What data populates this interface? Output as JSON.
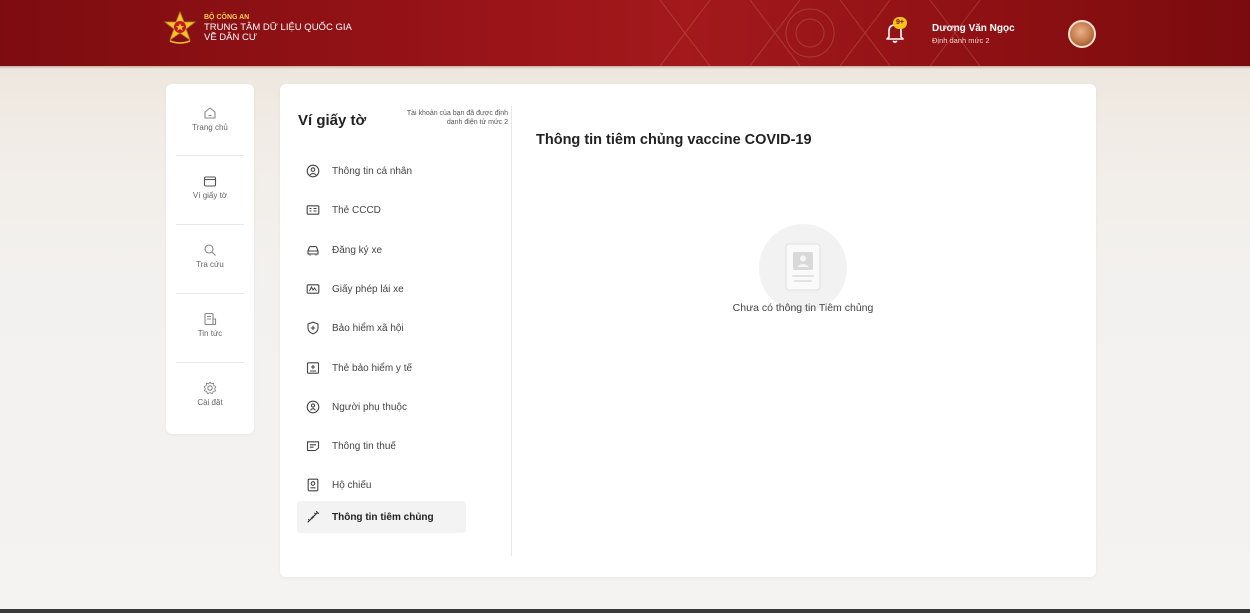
{
  "header": {
    "org_line1": "BỘ CÔNG AN",
    "org_line2": "TRUNG TÂM DỮ LIỆU QUỐC GIA",
    "org_line3": "VỀ DÂN CƯ",
    "notification_badge": "9+",
    "user_name": "Dương Văn Ngọc",
    "user_level": "Định danh mức 2",
    "brand_color": "#9a1418"
  },
  "rail": {
    "items": [
      {
        "label": "Trang chủ",
        "icon": "home-icon"
      },
      {
        "label": "Ví giấy tờ",
        "icon": "wallet-icon"
      },
      {
        "label": "Tra cứu",
        "icon": "search-icon"
      },
      {
        "label": "Tin tức",
        "icon": "news-icon"
      },
      {
        "label": "Cài đặt",
        "icon": "gear-icon"
      }
    ]
  },
  "wallet": {
    "title": "Ví giấy tờ",
    "note": "Tài khoản của bạn đã được định danh điện tử mức 2",
    "menu": [
      {
        "label": "Thông tin cá nhân",
        "icon": "person-circle-icon"
      },
      {
        "label": "Thẻ CCCD",
        "icon": "id-card-icon"
      },
      {
        "label": "Đăng ký xe",
        "icon": "car-icon"
      },
      {
        "label": "Giấy phép lái xe",
        "icon": "license-icon"
      },
      {
        "label": "Bảo hiểm xã hội",
        "icon": "shield-plus-icon"
      },
      {
        "label": "Thẻ bảo hiểm y tế",
        "icon": "health-card-icon"
      },
      {
        "label": "Người phụ thuộc",
        "icon": "dependent-icon"
      },
      {
        "label": "Thông tin thuế",
        "icon": "tax-icon"
      },
      {
        "label": "Hộ chiếu",
        "icon": "passport-icon"
      },
      {
        "label": "Thông tin tiêm chủng",
        "icon": "syringe-icon",
        "active": true
      }
    ]
  },
  "content": {
    "title": "Thông tin tiêm chủng vaccine COVID-19",
    "empty_message": "Chưa có thông tin Tiêm chủng"
  }
}
